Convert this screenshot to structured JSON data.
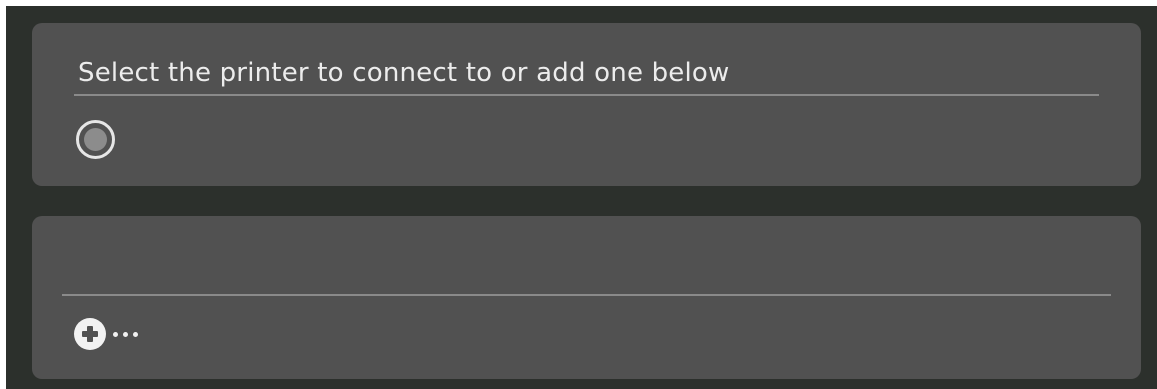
{
  "printer_selection": {
    "prompt": "Select the printer to connect to or add one below",
    "printers": [
      {
        "label": "",
        "selected": false
      }
    ]
  },
  "add_printer": {
    "icon": "plus-circle-icon",
    "more_icon": "ellipsis-icon"
  }
}
